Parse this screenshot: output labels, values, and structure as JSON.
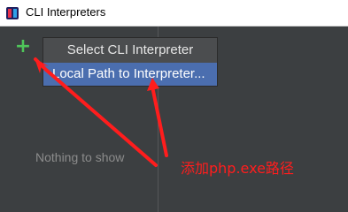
{
  "window": {
    "title": "CLI Interpreters",
    "icon": "app-icon"
  },
  "toolbar": {
    "add_label": "+",
    "add_icon": "plus-icon",
    "add_color": "#4fc65a"
  },
  "list": {
    "empty_text": "Nothing to show"
  },
  "popup": {
    "header": "Select CLI Interpreter",
    "items": [
      {
        "label": "Local Path to Interpreter..."
      }
    ],
    "selected_color": "#4b6eaf"
  },
  "annotation": {
    "text": "添加php.exe路径",
    "color": "#ff1d1d"
  }
}
